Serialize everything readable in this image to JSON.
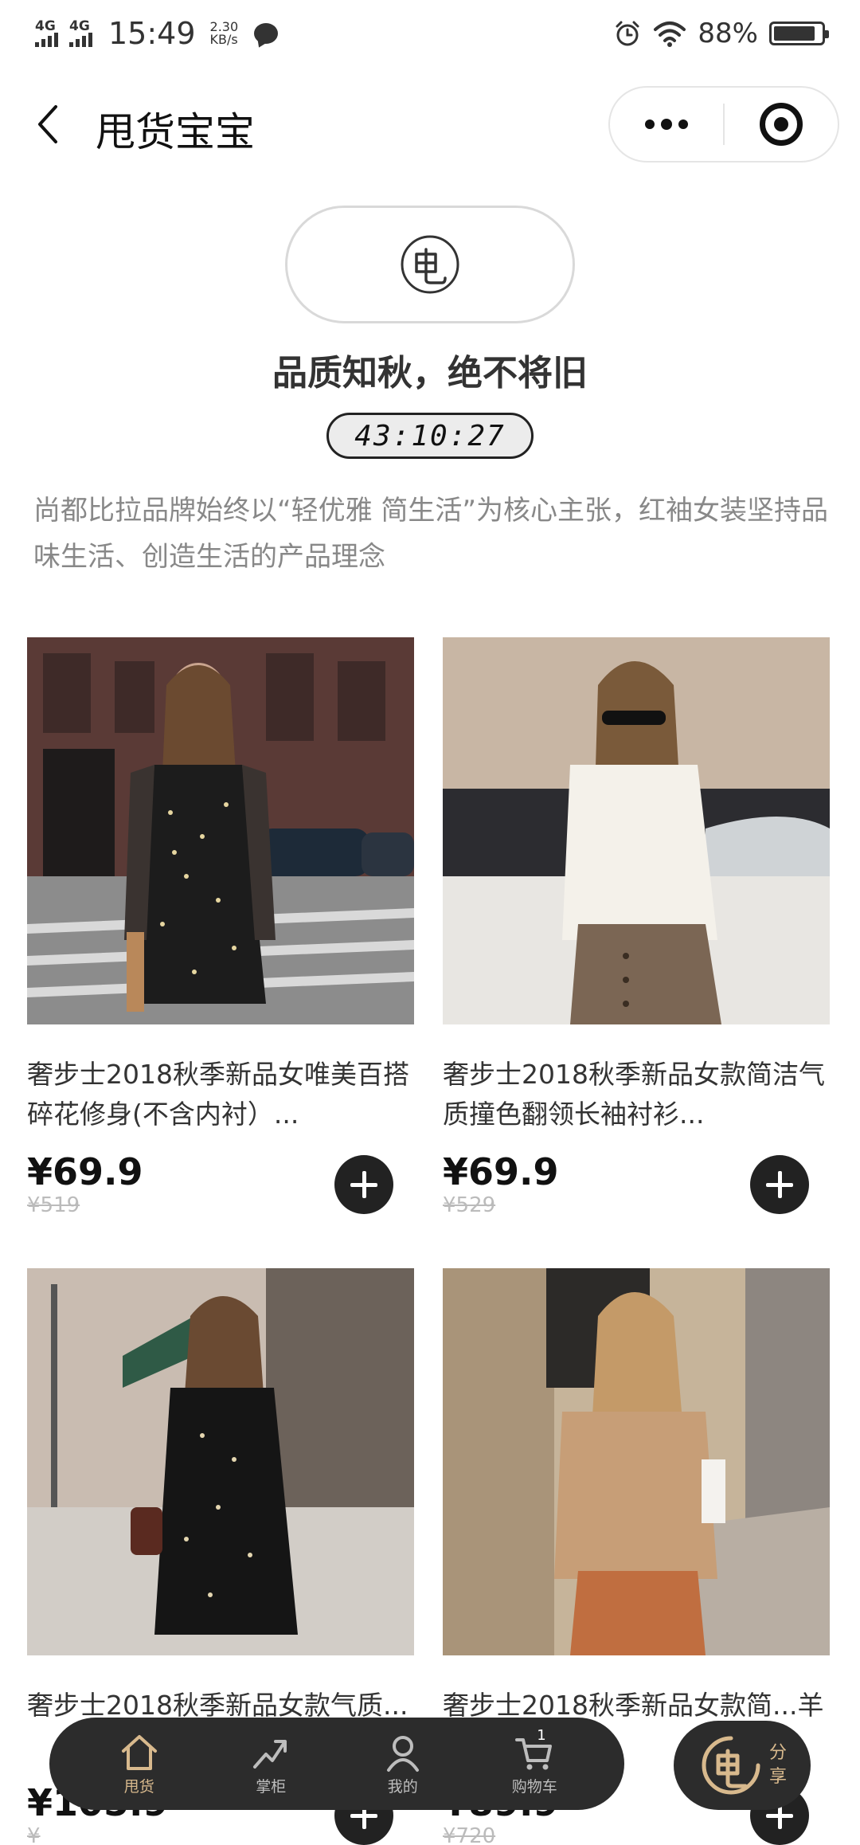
{
  "status_bar": {
    "signal_1": "4G",
    "signal_2": "4G",
    "time": "15:49",
    "net_speed": "2.30",
    "net_unit": "KB/s",
    "battery": "88%",
    "battery_level": 0.88,
    "icons": [
      "signal-icon",
      "chat-icon",
      "alarm-icon",
      "wifi-icon",
      "battery-icon"
    ]
  },
  "nav": {
    "title": "甩货宝宝",
    "icons": [
      "back-icon",
      "more-icon",
      "target-icon"
    ]
  },
  "header": {
    "headline": "品质知秋，绝不将旧",
    "countdown": "43:10:27",
    "description": "尚都比拉品牌始终以“轻优雅 简生活”为核心主张，红袖女装坚持品味生活、创造生活的产品理念"
  },
  "products": [
    {
      "name": "奢步士2018秋季新品女唯美百搭碎花修身(不含内衬）...",
      "price": "¥69.9",
      "original_price": "¥519"
    },
    {
      "name": "奢步士2018秋季新品女款简洁气质撞色翻领长袖衬衫...",
      "price": "¥69.9",
      "original_price": "¥529"
    },
    {
      "name": "奢步士2018秋季新品女款气质...",
      "price": "¥105.9",
      "original_price": "¥"
    },
    {
      "name": "奢步士2018秋季新品女款简...羊毛...",
      "price": "¥89.9",
      "original_price": "¥720"
    }
  ],
  "tab_bar": {
    "tabs": [
      {
        "label": "甩货",
        "icon": "home-icon"
      },
      {
        "label": "掌柜",
        "icon": "trend-icon"
      },
      {
        "label": "我的",
        "icon": "user-icon"
      },
      {
        "label": "购物车",
        "icon": "cart-icon"
      }
    ],
    "cart_count": "1",
    "active_color": "#d8b98d"
  },
  "share": {
    "line1": "分",
    "line2": "享"
  }
}
